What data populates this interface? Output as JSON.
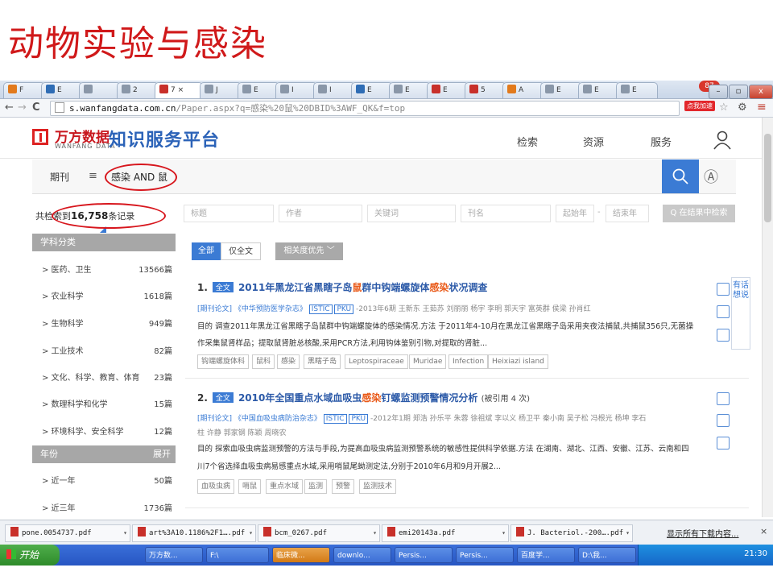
{
  "slide": {
    "title": "动物实验与感染"
  },
  "browser": {
    "tabs": [
      {
        "label": "F"
      },
      {
        "label": "E"
      },
      {
        "label": ""
      },
      {
        "label": "2"
      },
      {
        "label": "7 ×",
        "active": true
      },
      {
        "label": "J"
      },
      {
        "label": "E"
      },
      {
        "label": "I"
      },
      {
        "label": "I"
      },
      {
        "label": "E"
      },
      {
        "label": "E"
      },
      {
        "label": "E"
      },
      {
        "label": "5"
      },
      {
        "label": "A"
      },
      {
        "label": "E"
      },
      {
        "label": "E"
      },
      {
        "label": "E"
      }
    ],
    "profile_count": "87",
    "window_controls": [
      "–",
      "▫",
      "x"
    ],
    "url_host": "s.wanfangdata.com.cn",
    "url_path": "/Paper.aspx?q=感染%20鼠%20DBID%3AWF_QK&f=top",
    "extension_label": "点我加速"
  },
  "site": {
    "logo_cn": "万方数据",
    "logo_en": "WANFANG DATA",
    "platform_title": "知识服务平台",
    "nav": [
      "检索",
      "资源",
      "服务"
    ]
  },
  "search": {
    "category": "期刊",
    "query": "感染 AND 鼠"
  },
  "results": {
    "count_prefix": "共检索到",
    "count": "16,758",
    "count_suffix": "条记录",
    "filters": {
      "title_ph": "标题",
      "author_ph": "作者",
      "keyword_ph": "关键词",
      "journal_ph": "刊名",
      "start_year_ph": "起始年",
      "dash": "-",
      "end_year_ph": "结束年",
      "search_in_results": "Q 在结果中检索"
    },
    "sort": {
      "all": "全部",
      "fulltext_only": "仅全文",
      "relevance": "相关度优先  ﹀"
    }
  },
  "sidebar": {
    "subject_head": "学科分类",
    "subjects": [
      {
        "label": "> 医药、卫生",
        "count": "13566篇"
      },
      {
        "label": "> 农业科学",
        "count": "1618篇"
      },
      {
        "label": "> 生物科学",
        "count": "949篇"
      },
      {
        "label": "> 工业技术",
        "count": "82篇"
      },
      {
        "label": "> 文化、科学、教育、体育",
        "count": "23篇"
      },
      {
        "label": "> 数理科学和化学",
        "count": "15篇"
      },
      {
        "label": "> 环境科学、安全科学",
        "count": "12篇"
      }
    ],
    "year_head": "年份",
    "year_more": "展开",
    "years": [
      {
        "label": "> 近一年",
        "count": "50篇"
      },
      {
        "label": "> 近三年",
        "count": "1736篇"
      }
    ]
  },
  "items": [
    {
      "num": "1.",
      "tag": "全文",
      "title_a": "2011年黑龙江省黑瞎子岛",
      "title_hl1": "鼠",
      "title_b": "群中钩端螺旋体",
      "title_hl2": "感染",
      "title_c": "状况调查",
      "meta_a": "[期刊论文] 《中华预防医学杂志》",
      "meta_b": "ISTIC",
      "meta_c": "PKU",
      "meta_d": "-2013年6期 王新东 王茹苏 刘丽丽 杨宇 李明 郭天宇 富英群 侯梁 孙肖红",
      "abs1": "目的 调查2011年黑龙江省黑瞎子岛鼠群中钩端螺旋体的感染情况.方法 于2011年4-10月在黑龙江省黑瞎子岛采用夹夜法捕鼠,共捕鼠356只,无菌操",
      "abs2": "作采集鼠肾样品；提取鼠肾脏总核酸,采用PCR方法,利用钩体鉴别引物,对提取的肾脏...",
      "keywords": [
        "钩端螺旋体科",
        "鼠科",
        "感染",
        "黑瞎子岛",
        "Leptospiraceae",
        "Muridae",
        "Infection",
        "Heixiazi island"
      ]
    },
    {
      "num": "2.",
      "tag": "全文",
      "title_a": "2010年全国重点水域血吸虫",
      "title_hl1": "感染",
      "title_b": "钉螺监测预警情况分析",
      "title_hl2": "",
      "title_c": "",
      "cited": "(被引用 4 次)",
      "meta_a": "[期刊论文] 《中国血吸虫病防治杂志》",
      "meta_b": "ISTIC",
      "meta_c": "PKU",
      "meta_d": "-2012年1期 郑浩 孙乐平 朱蓉 徐祖斌 李以义 杨卫平 秦小南 吴子松 冯根光 杨坤 李石",
      "meta_e": "柱 许静 郭家钢 陈颖 周晓农",
      "abs1": "目的 探索血吸虫病监测预警的方法与手段,为提高血吸虫病监测预警系统的敏感性提供科学依据.方法 在湖南、湖北、江西、安徽、江苏、云南和四",
      "abs2": "川7个省选择血吸虫病易感重点水域,采用哨鼠尾蚴测定法,分别于2010年6月和9月开展2...",
      "keywords": [
        "血吸虫病",
        "哨鼠",
        "重点水域",
        "监测",
        "预警",
        "监测技术"
      ]
    }
  ],
  "feedback": "有话想说",
  "downloads": [
    {
      "name": "pone.0054737.pdf"
    },
    {
      "name": "art%3A10.1186%2F1….pdf"
    },
    {
      "name": "bcm_0267.pdf"
    },
    {
      "name": "emi20143a.pdf"
    },
    {
      "name": "J. Bacteriol.-200….pdf"
    }
  ],
  "downloads_show_all": "显示所有下载内容...",
  "taskbar": {
    "start": "开始",
    "items": [
      "万方数...",
      "F:\\",
      "临床微...",
      "downlo...",
      "Persis...",
      "Persis...",
      "百度学...",
      "D:\\我..."
    ],
    "clock": "21:30"
  }
}
